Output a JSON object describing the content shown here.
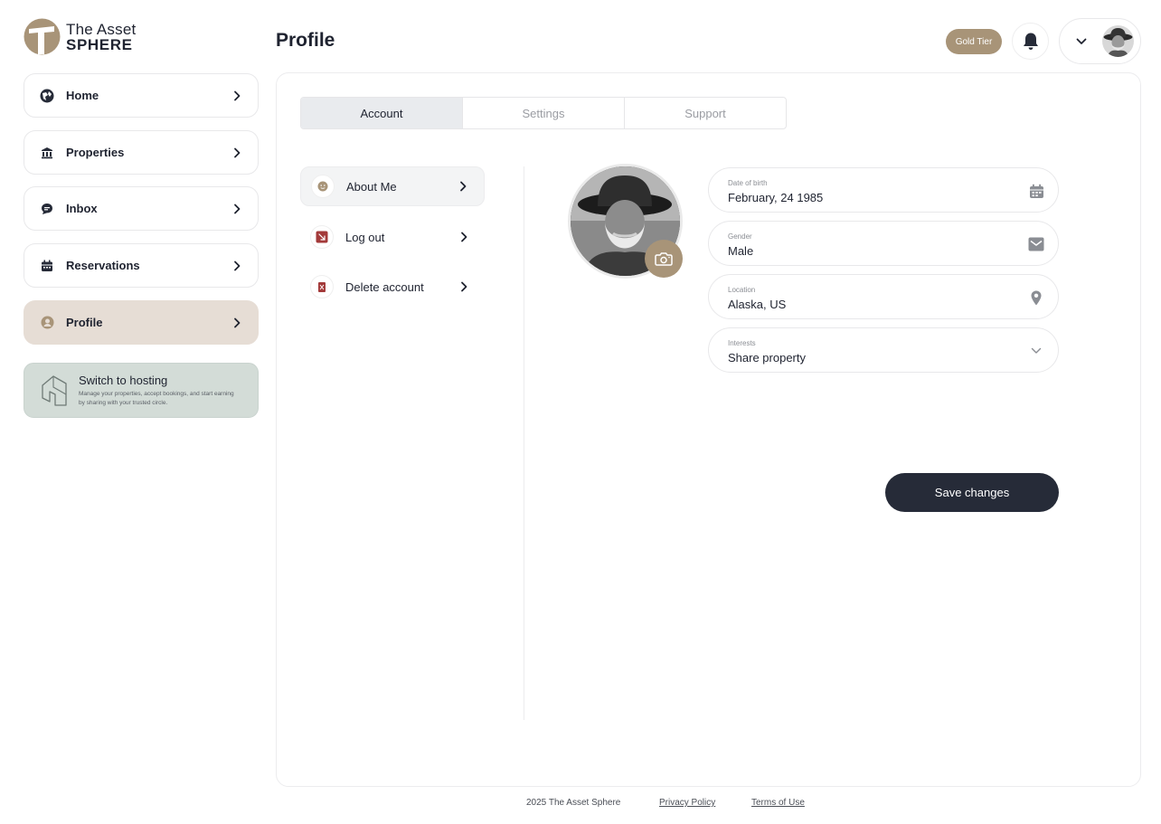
{
  "brand": {
    "line1": "The Asset",
    "line2": "SPHERE",
    "accent_color": "#a89478",
    "dark_color": "#262b38"
  },
  "sidebar": {
    "items": [
      {
        "label": "Home",
        "icon": "map-icon",
        "active": false
      },
      {
        "label": "Properties",
        "icon": "bank-icon",
        "active": false
      },
      {
        "label": "Inbox",
        "icon": "chat-icon",
        "active": false
      },
      {
        "label": "Reservations",
        "icon": "calendar-icon",
        "active": false
      },
      {
        "label": "Profile",
        "icon": "user-icon",
        "active": true
      }
    ],
    "hosting": {
      "title": "Switch to hosting",
      "description": "Manage your properties, accept bookings, and start earning by sharing with your trusted circle.",
      "icon": "house-outline-icon"
    }
  },
  "header": {
    "title": "Profile",
    "tier": "Gold Tier",
    "notification_icon": "bell-icon",
    "menu_icon": "chevron-down-icon"
  },
  "tabs": [
    {
      "label": "Account",
      "active": true
    },
    {
      "label": "Settings",
      "active": false
    },
    {
      "label": "Support",
      "active": false
    }
  ],
  "submenu": [
    {
      "label": "About Me",
      "icon": "smiley-icon",
      "active": true
    },
    {
      "label": "Log out",
      "icon": "logout-icon",
      "active": false
    },
    {
      "label": "Delete account",
      "icon": "trash-icon",
      "active": false
    }
  ],
  "profile": {
    "camera_icon": "camera-icon",
    "fields": [
      {
        "label": "Date of birth",
        "value": "February, 24 1985",
        "icon": "calendar-icon"
      },
      {
        "label": "Gender",
        "value": "Male",
        "icon": "mail-icon"
      },
      {
        "label": "Location",
        "value": "Alaska, US",
        "icon": "location-pin-icon"
      },
      {
        "label": "Interests",
        "value": "Share property",
        "icon": "chevron-down-icon"
      }
    ],
    "save_label": "Save changes"
  },
  "footer": {
    "copyright": "2025 The Asset Sphere",
    "privacy": "Privacy Policy",
    "terms": "Terms of Use"
  }
}
